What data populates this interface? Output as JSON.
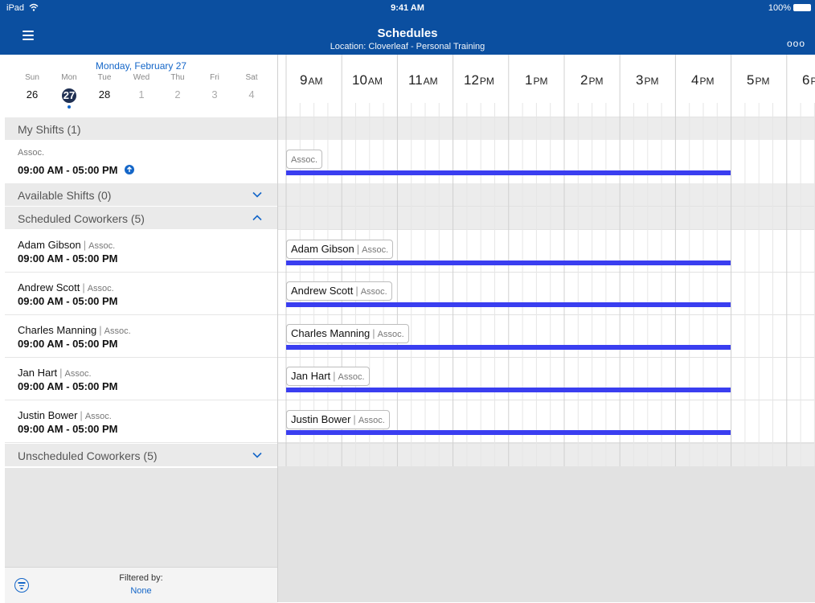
{
  "status_bar": {
    "device": "iPad",
    "time": "9:41 AM",
    "battery": "100%"
  },
  "header": {
    "title": "Schedules",
    "subtitle": "Location: Cloverleaf - Personal Training",
    "more_label": "ooo"
  },
  "calendar": {
    "selected_date": "Monday, February 27",
    "days": [
      {
        "name": "Sun",
        "num": "26",
        "state": "normal"
      },
      {
        "name": "Mon",
        "num": "27",
        "state": "today"
      },
      {
        "name": "Tue",
        "num": "28",
        "state": "normal"
      },
      {
        "name": "Wed",
        "num": "1",
        "state": "muted"
      },
      {
        "name": "Thu",
        "num": "2",
        "state": "muted"
      },
      {
        "name": "Fri",
        "num": "3",
        "state": "muted"
      },
      {
        "name": "Sat",
        "num": "4",
        "state": "muted"
      }
    ]
  },
  "sections": {
    "my_shifts": "My Shifts (1)",
    "available_shifts": "Available Shifts (0)",
    "scheduled_coworkers": "Scheduled Coworkers (5)",
    "unscheduled_coworkers": "Unscheduled Coworkers (5)"
  },
  "my_shift": {
    "role": "Assoc.",
    "time": "09:00 AM - 05:00 PM"
  },
  "coworkers": [
    {
      "name": "Adam Gibson",
      "role": "Assoc.",
      "time": "09:00 AM - 05:00 PM"
    },
    {
      "name": "Andrew Scott",
      "role": "Assoc.",
      "time": "09:00 AM - 05:00 PM"
    },
    {
      "name": "Charles Manning",
      "role": "Assoc.",
      "time": "09:00 AM - 05:00 PM"
    },
    {
      "name": "Jan Hart",
      "role": "Assoc.",
      "time": "09:00 AM - 05:00 PM"
    },
    {
      "name": "Justin Bower",
      "role": "Assoc.",
      "time": "09:00 AM - 05:00 PM"
    }
  ],
  "timeline": {
    "hours": [
      {
        "n": "9",
        "s": "AM"
      },
      {
        "n": "10",
        "s": "AM"
      },
      {
        "n": "11",
        "s": "AM"
      },
      {
        "n": "12",
        "s": "PM"
      },
      {
        "n": "1",
        "s": "PM"
      },
      {
        "n": "2",
        "s": "PM"
      },
      {
        "n": "3",
        "s": "PM"
      },
      {
        "n": "4",
        "s": "PM"
      },
      {
        "n": "5",
        "s": "PM"
      },
      {
        "n": "6",
        "s": "PM"
      }
    ],
    "my_shift_chip": "Assoc.",
    "shift_color": "#3a3ef0"
  },
  "filter": {
    "label": "Filtered by:",
    "value": "None"
  },
  "colors": {
    "header_bg": "#0b4fa0",
    "accent": "#1466c8",
    "today_circle": "#1f2f52"
  }
}
